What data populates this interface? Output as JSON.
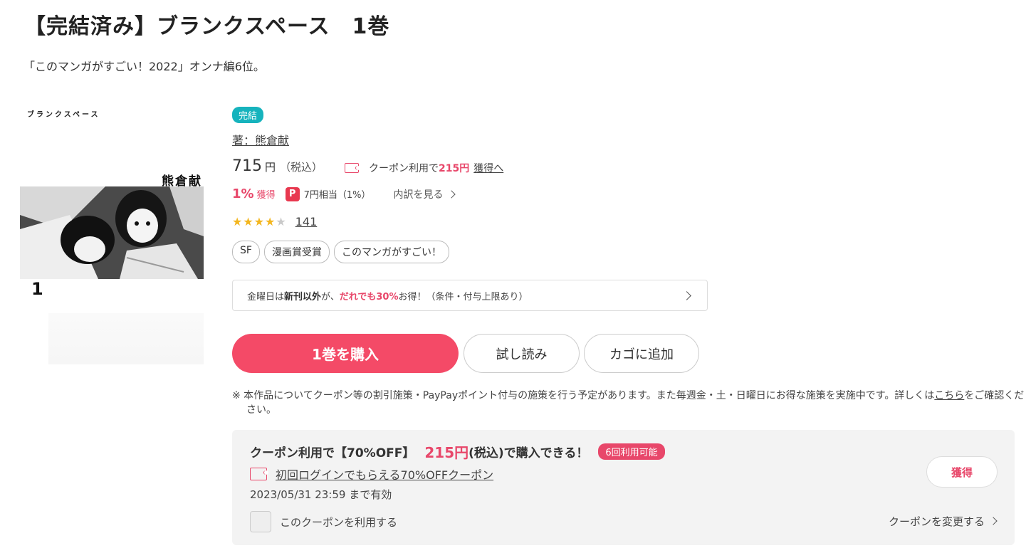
{
  "product": {
    "title": "【完結済み】ブランクスペース　1巻",
    "catchcopy": "「このマンガがすごい！2022」オンナ編6位。",
    "status_badge": "完結",
    "author": "著：熊倉献",
    "price": "715",
    "price_unit": "円",
    "tax_label": "（税込）",
    "rating_count": "141",
    "tags": [
      "SF",
      "漫画賞受賞",
      "このマンガがすごい！"
    ]
  },
  "cover": {
    "title_text": "ブランクスペース",
    "author_text": "熊倉献",
    "volume_text": "1"
  },
  "coupon_inline": {
    "prefix": "クーポン利用で",
    "amount": "215円",
    "link": "獲得へ"
  },
  "points": {
    "percent": "1%",
    "label": "獲得",
    "paypay_icon_letter": "P",
    "equiv": "7円相当（1%）",
    "breakdown": "内訳を見る"
  },
  "friday_banner": {
    "part1": "金曜日は",
    "bold": "新刊以外",
    "part2": "が、",
    "highlight": "だれでも30%",
    "part3": "お得！（条件・付与上限あり）"
  },
  "buttons": {
    "buy": "1巻を購入",
    "trial": "試し読み",
    "cart": "カゴに追加"
  },
  "notice": {
    "text": "※ 本作品についてクーポン等の割引施策・PayPayポイント付与の施策を行う予定があります。また毎週金・土・日曜日にお得な施策を実施中です。詳しくは",
    "link": "こちら",
    "tail": "をご確認ください。"
  },
  "coupon_box": {
    "head_prefix": "クーポン利用で【70%OFF】",
    "head_price": "215円",
    "head_tail": "(税込)で購入できる！",
    "badge": "6回利用可能",
    "coupon_name": "初回ログインでもらえる70%OFFクーポン",
    "expiry": "2023/05/31 23:59 まで有効",
    "checkbox_label": "このクーポンを利用する",
    "get_button": "獲得",
    "change_link": "クーポンを変更する"
  },
  "colors": {
    "accent_pink": "#f44a67",
    "teal_badge": "#16b3bd",
    "star": "#f3b61f"
  },
  "rating_value": 4.5
}
